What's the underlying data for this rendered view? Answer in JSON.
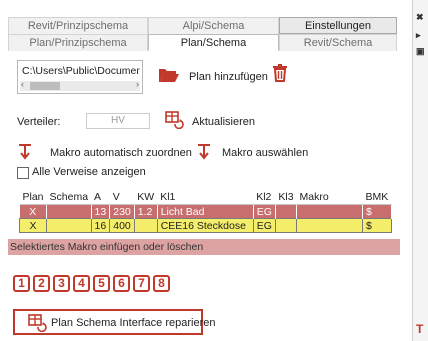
{
  "tabs_top": [
    {
      "label": "Revit/Prinzipschema"
    },
    {
      "label": "Alpi/Schema"
    },
    {
      "label": "Einstellungen"
    }
  ],
  "tabs_bottom": [
    {
      "label": "Plan/Prinzipschema"
    },
    {
      "label": "Plan/Schema"
    },
    {
      "label": "Revit/Schema"
    }
  ],
  "path": {
    "value": "C:\\Users\\Public\\Document"
  },
  "buttons": {
    "add_plan": "Plan hinzufügen",
    "refresh": "Aktualisieren",
    "macro_auto": "Makro automatisch zuordnen",
    "macro_select": "Makro auswählen",
    "repair": "Plan Schema Interface reparieren"
  },
  "distributor": {
    "label": "Verteiler:",
    "placeholder": "HV"
  },
  "show_all": {
    "label": "Alle Verweise anzeigen",
    "checked": false
  },
  "table": {
    "headers": [
      "Plan",
      "Schema",
      "A",
      "V",
      "KW",
      "Kl1",
      "Kl2",
      "Kl3",
      "Makro",
      "BMK"
    ],
    "rows": [
      {
        "plan": "X",
        "schema": "",
        "a": "13",
        "v": "230",
        "kw": "1.2",
        "kl1": "Licht Bad",
        "kl2": "EG",
        "kl3": "",
        "makro": "",
        "bmk": "$"
      },
      {
        "plan": "X",
        "schema": "",
        "a": "16",
        "v": "400",
        "kw": "",
        "kl1": "CEE16 Steckdose",
        "kl2": "EG",
        "kl3": "",
        "makro": "",
        "bmk": "$"
      }
    ]
  },
  "status": "Selektiertes Makro einfügen oder löschen",
  "numbers": [
    "1",
    "2",
    "3",
    "4",
    "5",
    "6",
    "7",
    "8"
  ],
  "colors": {
    "accent_red": "#c0392b",
    "row_selected": "#c86e6e",
    "row_highlight": "#f5ee6a",
    "status_bg": "#dda2a2"
  }
}
